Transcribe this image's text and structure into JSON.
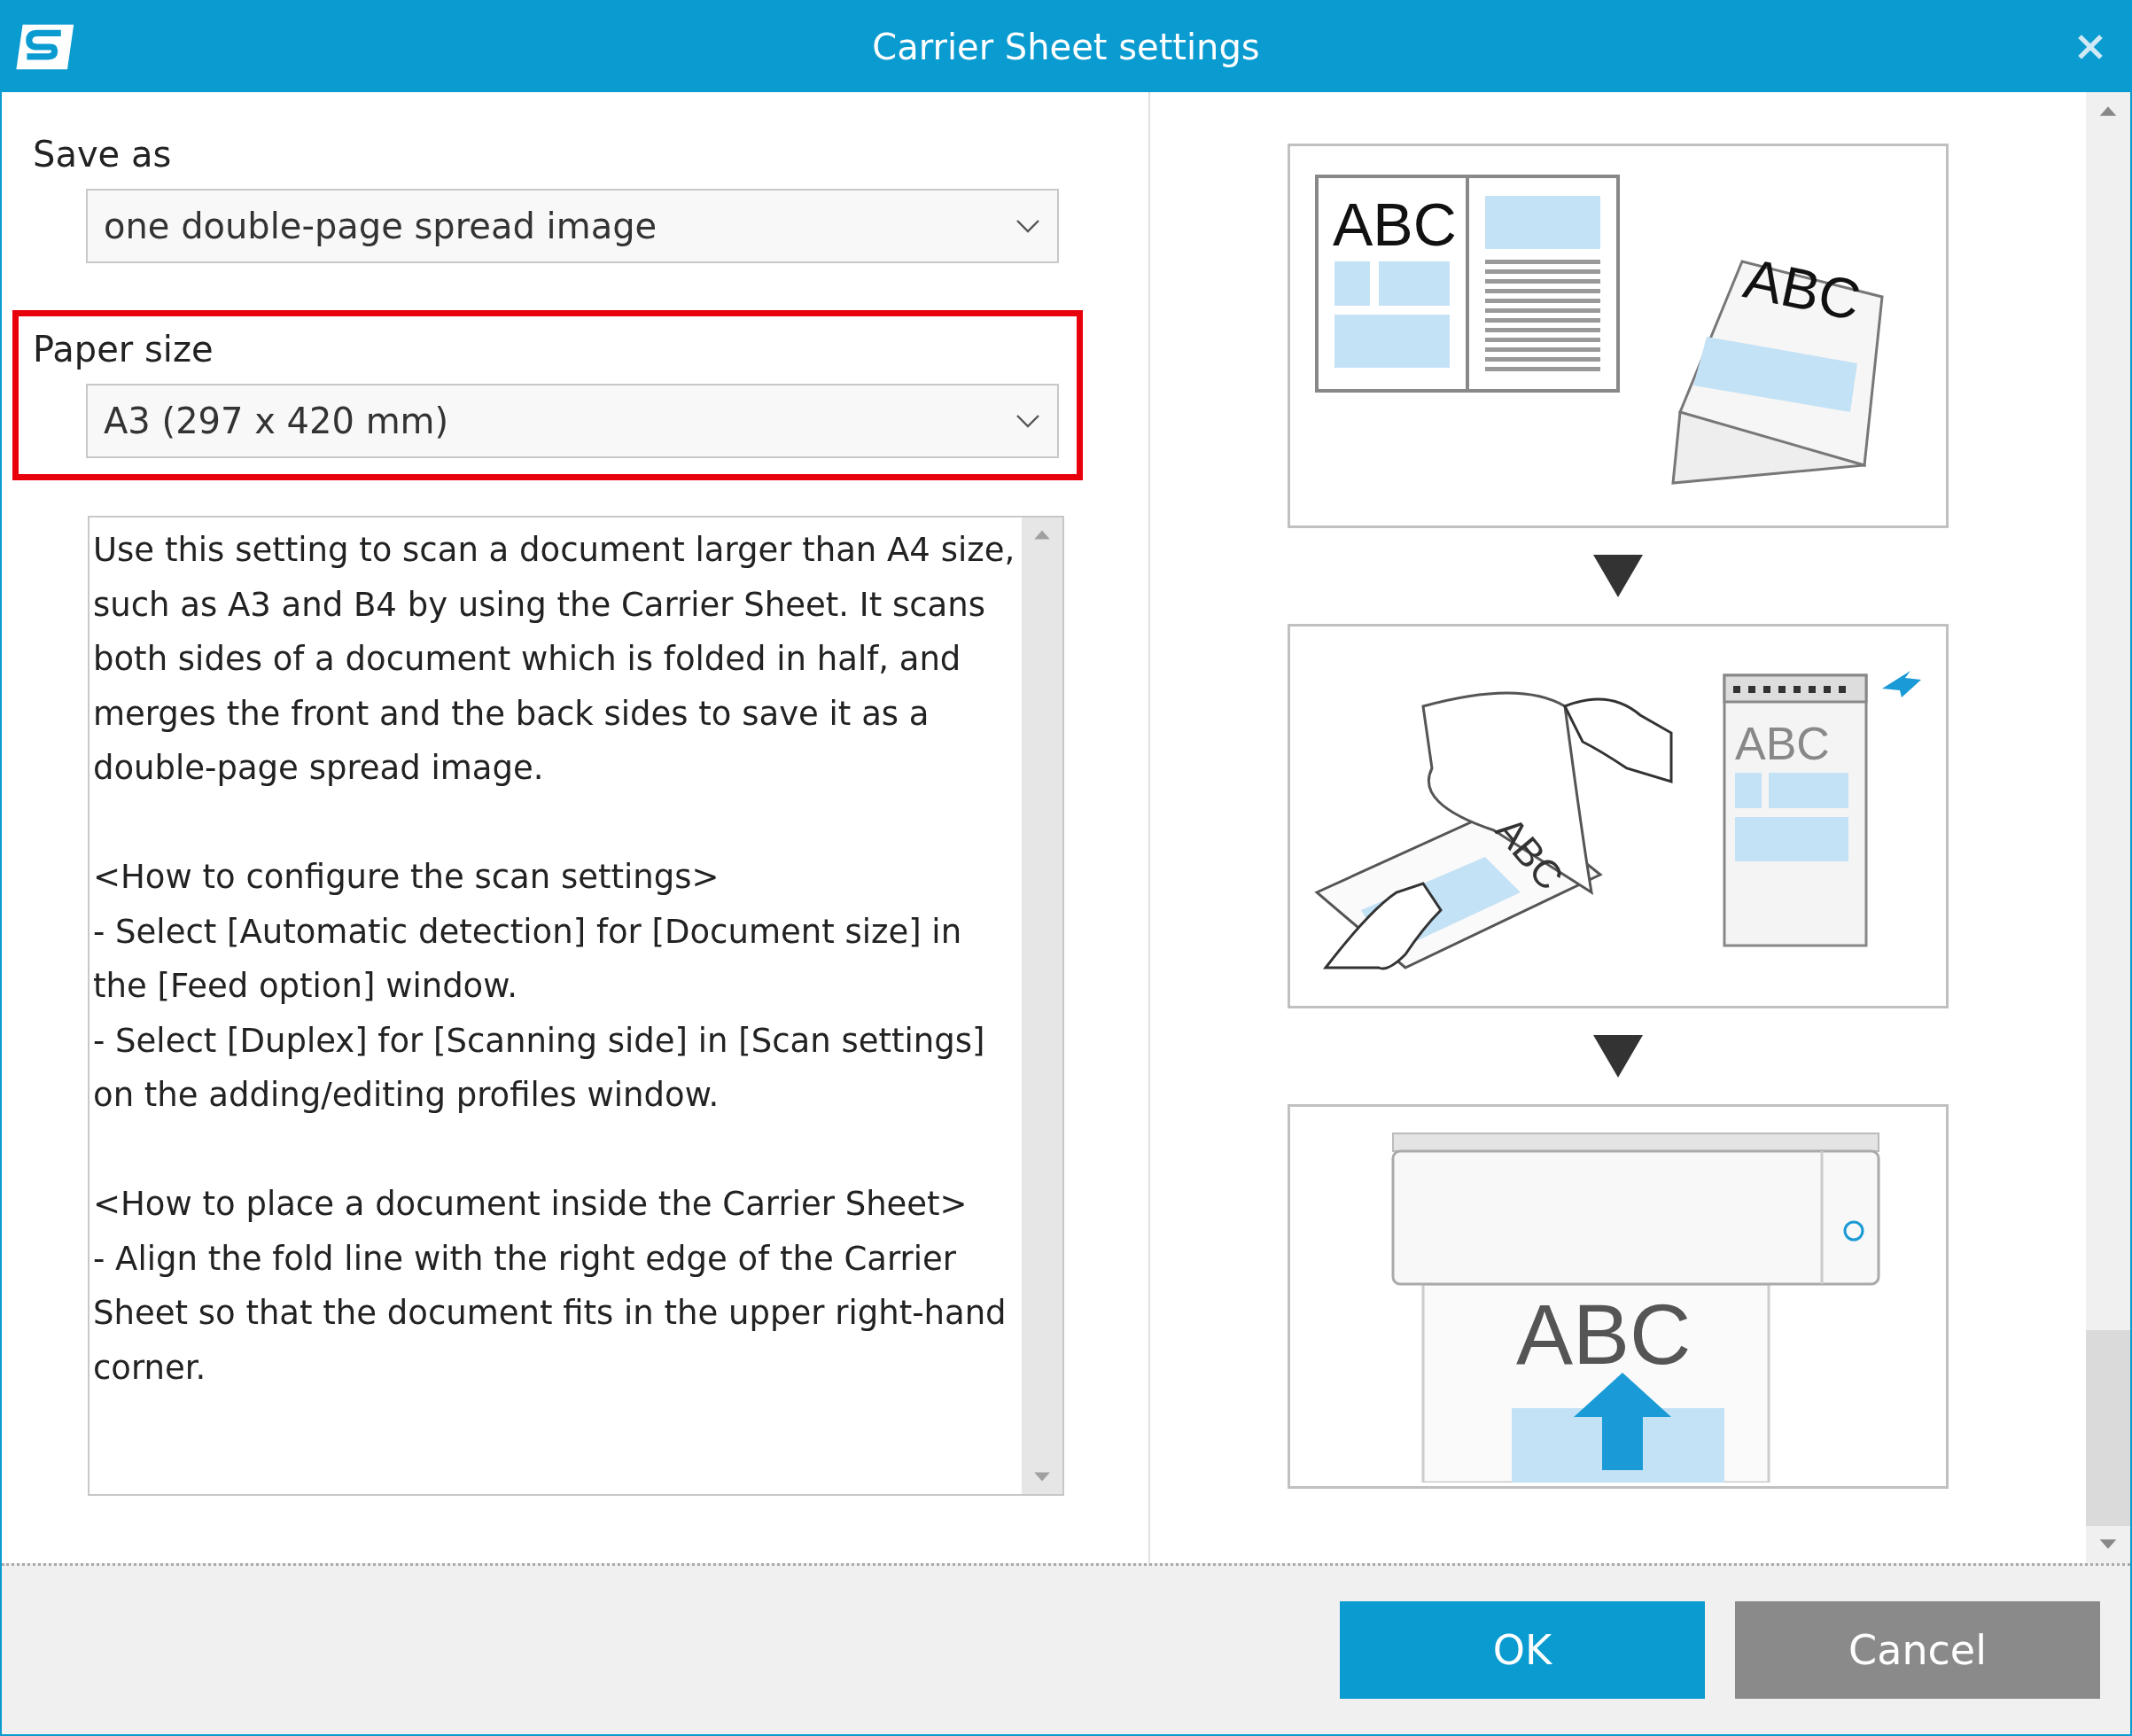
{
  "window": {
    "title": "Carrier Sheet settings"
  },
  "save_as": {
    "label": "Save as",
    "value": "one double-page spread image"
  },
  "paper_size": {
    "label": "Paper size",
    "value": "A3 (297 x 420 mm)",
    "highlighted": true
  },
  "description": [
    [
      "Use this setting to scan a document larger than A4 size, such as A3 and B4 by using the Carrier Sheet. It scans both sides of a document which is folded in half, and merges the front and the back sides to save it as a double-page spread image."
    ],
    [
      "<How to configure the scan settings>",
      "- Select [Automatic detection] for [Document size] in the [Feed option] window.",
      "- Select [Duplex] for [Scanning side] in [Scan settings] on the adding/editing profiles window."
    ],
    [
      "<How to place a document inside the Carrier Sheet>",
      "- Align the fold line with the right edge of the Carrier Sheet so that the document fits in the upper right-hand corner."
    ]
  ],
  "steps": [
    {
      "kind": "fold",
      "labels": [
        "ABC",
        "ABC"
      ]
    },
    {
      "kind": "insert",
      "labels": [
        "ABC",
        "ABC"
      ]
    },
    {
      "kind": "scan",
      "labels": [
        "ABC"
      ]
    }
  ],
  "buttons": [
    {
      "label": "OK",
      "kind": "primary"
    },
    {
      "label": "Cancel",
      "kind": "secondary"
    }
  ]
}
